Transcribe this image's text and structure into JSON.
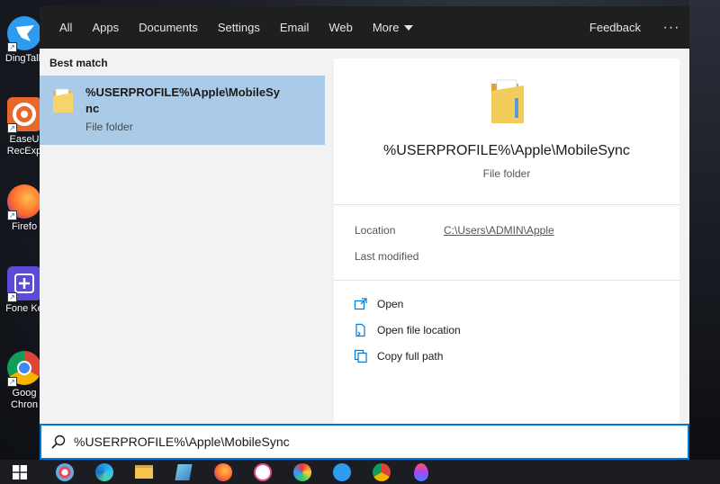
{
  "desktop": {
    "icons": [
      {
        "label": "DingTalk",
        "icon": "dingtalk-icon"
      },
      {
        "label": "EaseU RecExp",
        "icon": "recexperts-icon"
      },
      {
        "label": "Firefo",
        "icon": "firefox-icon"
      },
      {
        "label": "Fone Ke",
        "icon": "fonekeeper-icon"
      },
      {
        "label": "Goog Chron",
        "icon": "chrome-icon"
      }
    ]
  },
  "search": {
    "tabs": [
      "All",
      "Apps",
      "Documents",
      "Settings",
      "Email",
      "Web",
      "More"
    ],
    "feedback_label": "Feedback",
    "more_options": "···",
    "best_match_label": "Best match",
    "result": {
      "name": "%USERPROFILE%\\Apple\\MobileSync",
      "type": "File folder"
    },
    "detail": {
      "name": "%USERPROFILE%\\Apple\\MobileSync",
      "type": "File folder",
      "location_label": "Location",
      "location_value": "C:\\Users\\ADMIN\\Apple",
      "last_modified_label": "Last modified",
      "actions": [
        "Open",
        "Open file location",
        "Copy full path"
      ]
    },
    "query": "%USERPROFILE%\\Apple\\MobileSync"
  },
  "taskbar": {
    "apps": [
      "paint-icon",
      "edge-icon",
      "file-explorer-icon",
      "notepad-icon",
      "firefox-icon",
      "itunes-icon",
      "paint-brush-icon",
      "dingtalk-icon",
      "chrome-icon",
      "drop-icon"
    ]
  },
  "colors": {
    "accent": "#0078d7",
    "selection": "#aacbe7",
    "topbar": "#1f1f1f"
  }
}
